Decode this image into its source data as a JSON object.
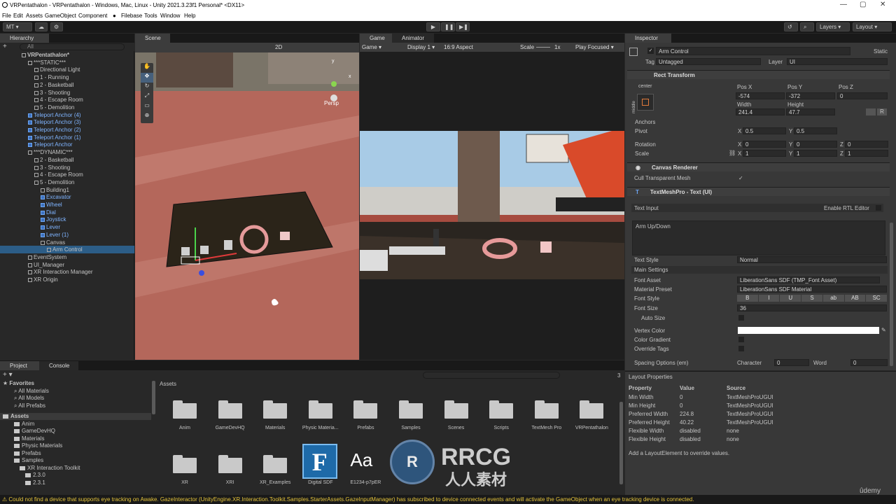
{
  "window": {
    "title": "VRPentathalon - VRPentathalon - Windows, Mac, Linux - Unity 2021.3.23f1 Personal* <DX11>"
  },
  "menu": [
    "File",
    "Edit",
    "Assets",
    "GameObject",
    "Component",
    "Filebase",
    "Tools",
    "Window",
    "Help"
  ],
  "toolbar": {
    "account": "MT",
    "layers": "Layers",
    "layout": "Layout"
  },
  "hierarchy": {
    "tab": "Hierarchy",
    "search_placeholder": "All",
    "rows": [
      {
        "label": "VRPentathalon*",
        "indent": 0,
        "blue": false,
        "bold": true
      },
      {
        "label": "***STATIC***",
        "indent": 1,
        "blue": false
      },
      {
        "label": "Directional Light",
        "indent": 2,
        "blue": false
      },
      {
        "label": "1 - Running",
        "indent": 2,
        "blue": false
      },
      {
        "label": "2 - Basketball",
        "indent": 2,
        "blue": false
      },
      {
        "label": "3 - Shooting",
        "indent": 2,
        "blue": false
      },
      {
        "label": "4 - Escape Room",
        "indent": 2,
        "blue": false
      },
      {
        "label": "5 - Demolition",
        "indent": 2,
        "blue": false
      },
      {
        "label": "Teleport Anchor (4)",
        "indent": 1,
        "blue": true
      },
      {
        "label": "Teleport Anchor (3)",
        "indent": 1,
        "blue": true
      },
      {
        "label": "Teleport Anchor (2)",
        "indent": 1,
        "blue": true
      },
      {
        "label": "Teleport Anchor (1)",
        "indent": 1,
        "blue": true
      },
      {
        "label": "Teleport Anchor",
        "indent": 1,
        "blue": true
      },
      {
        "label": "***DYNAMIC***",
        "indent": 1,
        "blue": false
      },
      {
        "label": "2 - Basketball",
        "indent": 2,
        "blue": false
      },
      {
        "label": "3 - Shooting",
        "indent": 2,
        "blue": false
      },
      {
        "label": "4 - Escape Room",
        "indent": 2,
        "blue": false
      },
      {
        "label": "5 - Demolition",
        "indent": 2,
        "blue": false
      },
      {
        "label": "Building1",
        "indent": 3,
        "blue": false
      },
      {
        "label": "Excavator",
        "indent": 3,
        "blue": true
      },
      {
        "label": "Wheel",
        "indent": 3,
        "blue": true
      },
      {
        "label": "Dial",
        "indent": 3,
        "blue": true
      },
      {
        "label": "Joystick",
        "indent": 3,
        "blue": true
      },
      {
        "label": "Lever",
        "indent": 3,
        "blue": true
      },
      {
        "label": "Lever (1)",
        "indent": 3,
        "blue": true
      },
      {
        "label": "Canvas",
        "indent": 3,
        "blue": false
      },
      {
        "label": "Arm Control",
        "indent": 4,
        "blue": false,
        "selected": true
      },
      {
        "label": "EventSystem",
        "indent": 1,
        "blue": false
      },
      {
        "label": "UI_Manager",
        "indent": 1,
        "blue": false
      },
      {
        "label": "XR Interaction Manager",
        "indent": 1,
        "blue": false
      },
      {
        "label": "XR Origin",
        "indent": 1,
        "blue": false
      }
    ]
  },
  "scene": {
    "tab": "Scene",
    "mode_2d": "2D",
    "persp": "Persp",
    "gizmo_y": "y",
    "gizmo_x": "x"
  },
  "game": {
    "tab": "Game",
    "tab2": "Animator",
    "display_mode": "Game",
    "display": "Display 1",
    "aspect": "16:9 Aspect",
    "scale_label": "Scale",
    "scale_value": "1x",
    "play_focused": "Play Focused"
  },
  "inspector": {
    "tab": "Inspector",
    "object_name": "Arm Control",
    "static_label": "Static",
    "tag_label": "Tag",
    "tag": "Untagged",
    "layer_label": "Layer",
    "layer": "UI",
    "rect_transform": {
      "title": "Rect Transform",
      "anchor_h": "center",
      "anchor_v": "middle",
      "posx_label": "Pos X",
      "posy_label": "Pos Y",
      "posz_label": "Pos Z",
      "posx": "-574",
      "posy": "-372",
      "posz": "0",
      "width_label": "Width",
      "height_label": "Height",
      "width": "241.4",
      "height": "47.7",
      "anchors": "Anchors",
      "pivot": "Pivot",
      "pivot_x": "0.5",
      "pivot_y": "0.5",
      "rotation": "Rotation",
      "rot_x": "0",
      "rot_y": "0",
      "rot_z": "0",
      "scale": "Scale",
      "scale_x": "1",
      "scale_y": "1",
      "scale_z": "1",
      "x": "X",
      "y": "Y",
      "z": "Z",
      "r_btn": "R"
    },
    "canvas_renderer": {
      "title": "Canvas Renderer",
      "cull_label": "Cull Transparent Mesh",
      "cull": "✓"
    },
    "tmp": {
      "title": "TextMeshPro - Text (UI)",
      "text_input": "Text Input",
      "rtl": "Enable RTL Editor",
      "text": "Arm Up/Down",
      "text_style_label": "Text Style",
      "text_style": "Normal",
      "main_settings": "Main Settings",
      "font_asset_label": "Font Asset",
      "font_asset": "LiberationSans SDF (TMP_Font Asset)",
      "material_label": "Material Preset",
      "material": "LiberationSans SDF Material",
      "font_style_label": "Font Style",
      "styles": [
        "B",
        "I",
        "U",
        "S",
        "ab",
        "AB",
        "SC"
      ],
      "font_size_label": "Font Size",
      "font_size": "36",
      "auto_size": "Auto Size",
      "vertex_color": "Vertex Color",
      "gradient": "Color Gradient",
      "override_tags": "Override Tags",
      "spacing_label": "Spacing Options (em)",
      "character": "Character",
      "character_val": "0",
      "word": "Word",
      "word_val": "0"
    }
  },
  "layout_props": {
    "title": "Layout Properties",
    "headers": [
      "Property",
      "Value",
      "Source"
    ],
    "rows": [
      [
        "Min Width",
        "0",
        "TextMeshProUGUI"
      ],
      [
        "Min Height",
        "0",
        "TextMeshProUGUI"
      ],
      [
        "Preferred Width",
        "224.8",
        "TextMeshProUGUI"
      ],
      [
        "Preferred Height",
        "40.22",
        "TextMeshProUGUI"
      ],
      [
        "Flexible Width",
        "disabled",
        "none"
      ],
      [
        "Flexible Height",
        "disabled",
        "none"
      ]
    ],
    "note": "Add a LayoutElement to override values."
  },
  "project": {
    "tab": "Project",
    "tab2": "Console",
    "favorites": "Favorites",
    "fav_items": [
      "All Materials",
      "All Models",
      "All Prefabs"
    ],
    "assets_root": "Assets",
    "tree": [
      "Anim",
      "GameDevHQ",
      "Materials",
      "Physic Materials",
      "Prefabs",
      "Samples",
      "XR Interaction Toolkit",
      "2.3.0",
      "2.3.1"
    ],
    "breadcrumb": "Assets",
    "folders": [
      "Anim",
      "GameDevHQ",
      "Materials",
      "Physic Materia...",
      "Prefabs",
      "Samples",
      "Scenes",
      "Scripts",
      "TextMesh Pro",
      "VRPentathalon"
    ],
    "row2": [
      "XR",
      "XRI",
      "XR_Examples",
      "Digital SDF",
      "E1234-p7pER"
    ],
    "count": "3"
  },
  "status": {
    "message": "Could not find a device that supports eye tracking on Awake. GazeInteractor (UnityEngine.XR.Interaction.Toolkit.Samples.StarterAssets.GazeInputManager) has subscribed to device connected events and will activate the GameObject when an eye tracking device is connected."
  },
  "watermark": {
    "brand": "RRCG",
    "cn": "人人素材",
    "udemy": "ûdemy"
  }
}
